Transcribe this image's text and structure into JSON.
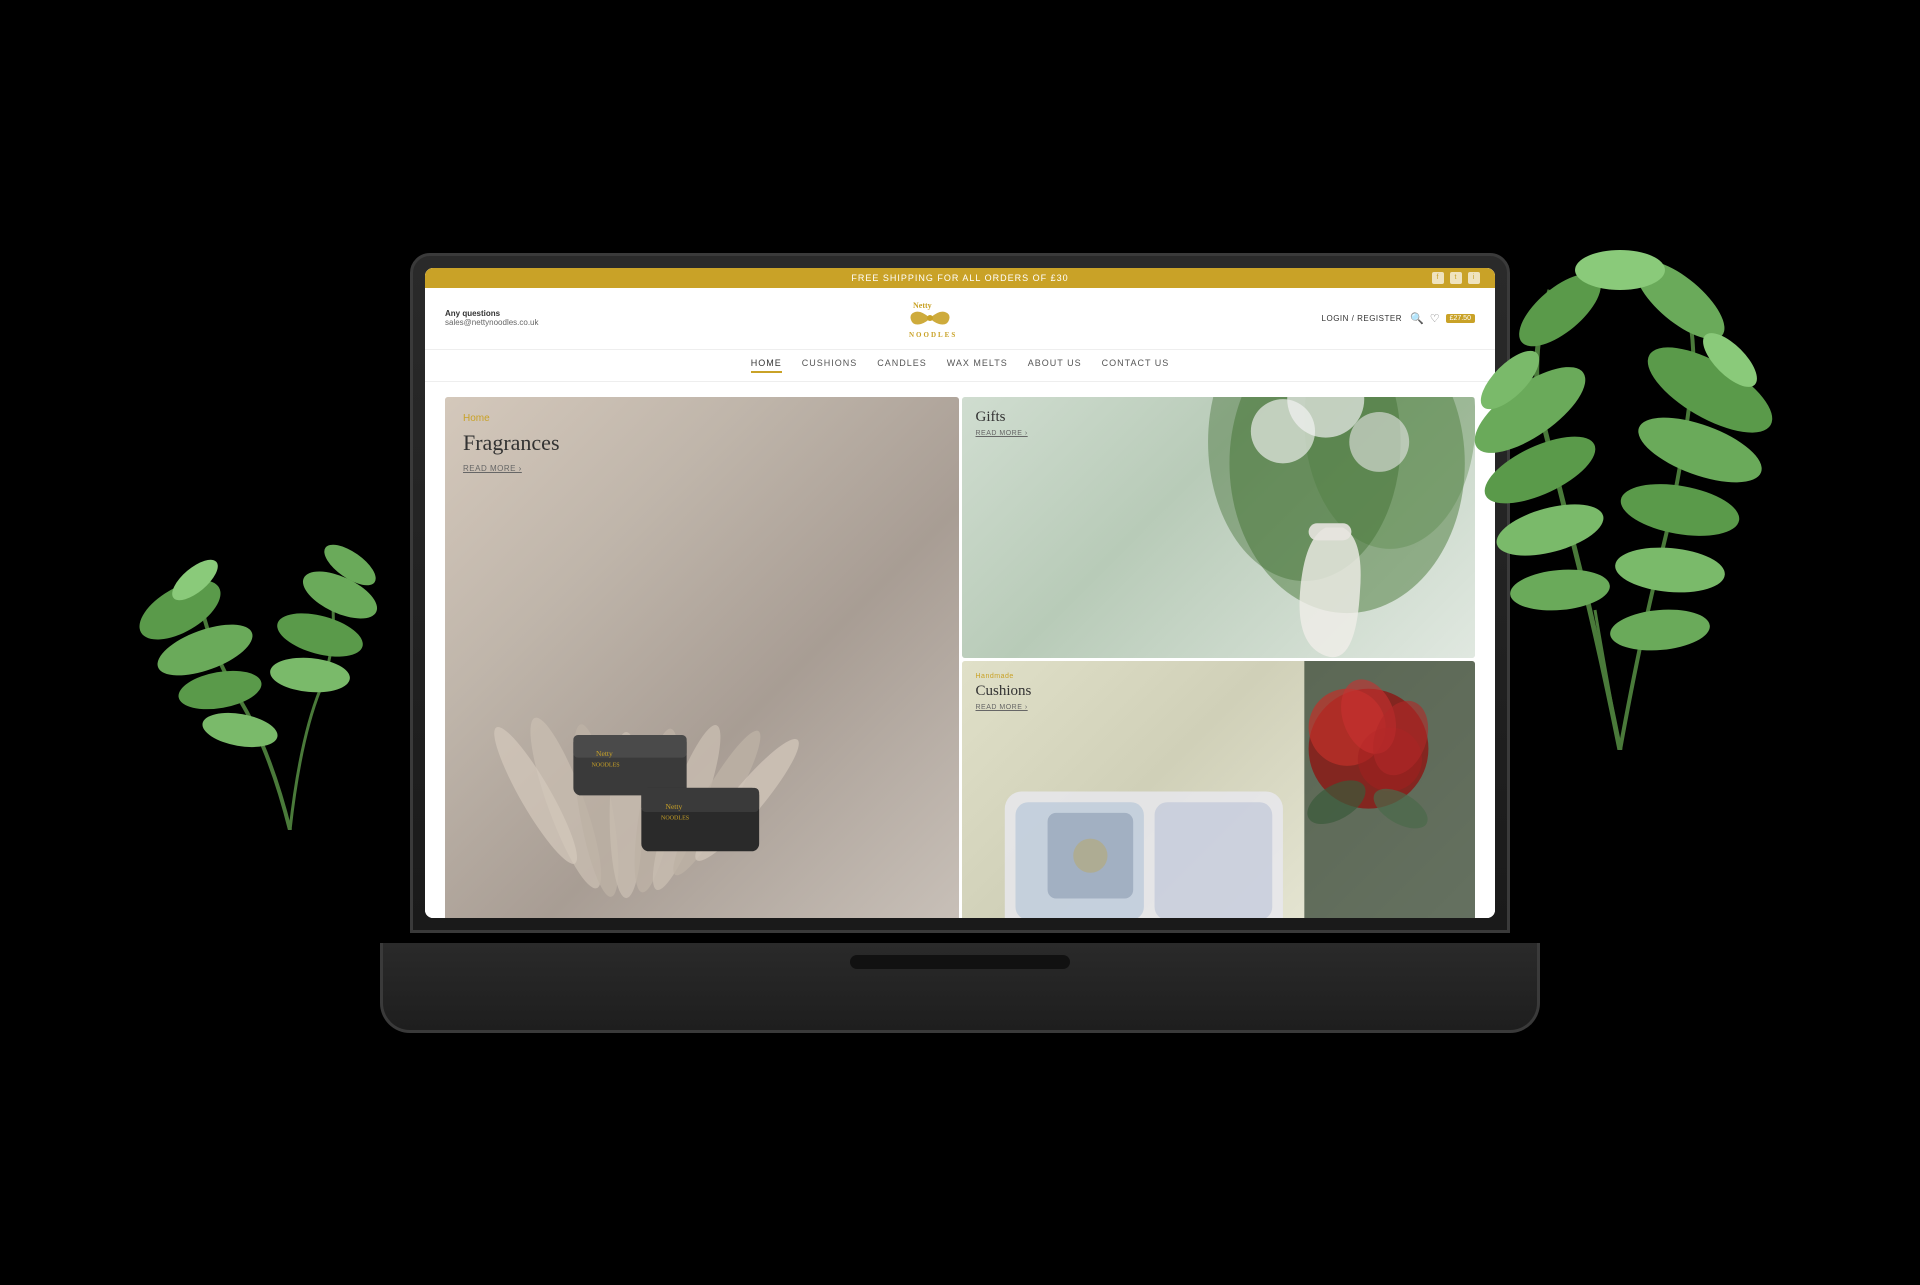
{
  "page": {
    "background": "#000000"
  },
  "top_banner": {
    "text": "FREE SHIPPING FOR ALL ORDERS OF £30",
    "social": [
      "f",
      "t",
      "i"
    ]
  },
  "header": {
    "any_questions_label": "Any questions",
    "email": "sales@nettynoodles.co.uk",
    "logo_line1": "Netty",
    "logo_line2": "NOODLES",
    "login_register": "LOGIN / REGISTER",
    "cart_amount": "£27.50"
  },
  "nav": {
    "items": [
      {
        "label": "HOME",
        "active": true
      },
      {
        "label": "CUSHIONS",
        "active": false
      },
      {
        "label": "CANDLES",
        "active": false
      },
      {
        "label": "WAX MELTS",
        "active": false
      },
      {
        "label": "ABOUT US",
        "active": false
      },
      {
        "label": "CONTACT US",
        "active": false
      }
    ]
  },
  "hero": {
    "home_label": "Home",
    "title": "Fragrances",
    "read_more": "READ MORE ›"
  },
  "gifts": {
    "title": "Gifts",
    "read_more": "READ MORE ›"
  },
  "cushions": {
    "handmade_label": "Handmade",
    "title": "Cushions",
    "read_more": "READ MORE ›"
  },
  "fourth_panel": {
    "description": "Dark floral cushion panel"
  }
}
